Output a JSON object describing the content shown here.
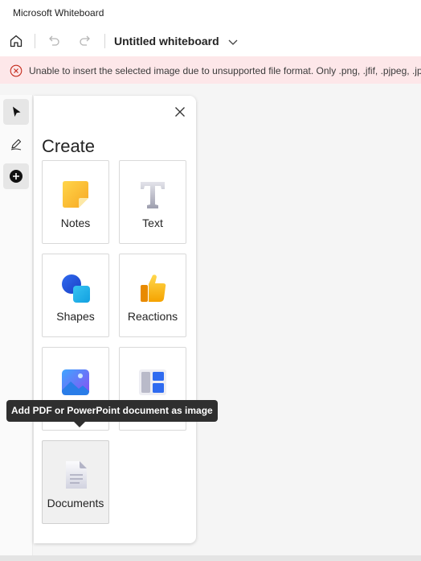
{
  "app": {
    "title": "Microsoft Whiteboard"
  },
  "toolbar": {
    "home_icon": "home-icon",
    "undo_icon": "undo-icon",
    "redo_icon": "redo-icon",
    "whiteboard_title": "Untitled whiteboard",
    "title_chevron_icon": "chevron-down-icon"
  },
  "error": {
    "icon": "error-circle-icon",
    "message": "Unable to insert the selected image due to unsupported file format. Only .png, .jfif, .pjpeg, .jpeg, .pjp, .jpg, .gif, .bmp"
  },
  "rail": {
    "items": [
      {
        "name": "select-tool",
        "icon": "cursor-icon"
      },
      {
        "name": "inking-tool",
        "icon": "pen-icon"
      },
      {
        "name": "create-tool",
        "icon": "plus-circle-icon",
        "active": true
      }
    ]
  },
  "panel": {
    "title": "Create",
    "close_icon": "close-icon",
    "tiles": [
      {
        "label": "Notes",
        "icon": "sticky-note-icon"
      },
      {
        "label": "Text",
        "icon": "text-icon"
      },
      {
        "label": "Shapes",
        "icon": "shapes-icon"
      },
      {
        "label": "Reactions",
        "icon": "thumbs-up-icon"
      },
      {
        "label": "",
        "icon": "image-icon"
      },
      {
        "label": "",
        "icon": "templates-icon"
      },
      {
        "label": "Documents",
        "icon": "document-icon"
      }
    ]
  },
  "tooltip": {
    "text": "Add PDF or PowerPoint document as image"
  },
  "colors": {
    "error_bg": "#fde7e9",
    "error_icon": "#c42b1c",
    "tooltip_bg": "#2f2f2f",
    "canvas_bg": "#f5f5f5"
  }
}
